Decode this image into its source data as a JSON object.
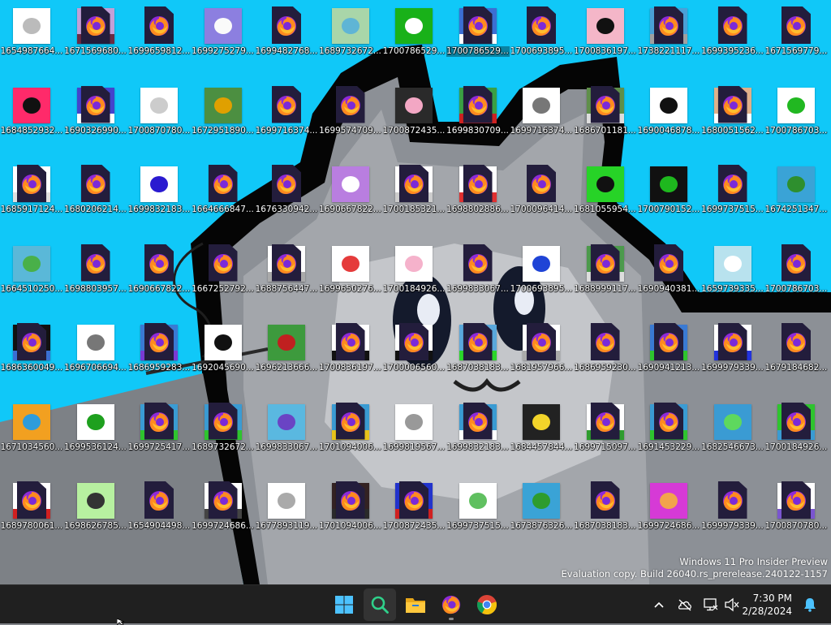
{
  "desktop": {
    "icons": [
      {
        "label": "1654987664...",
        "kind": "image",
        "color": "#ffffff",
        "accent": "#bbbbbb"
      },
      {
        "label": "1671569680...",
        "kind": "firefox_thumb",
        "color": "#c2a0d6",
        "accent": "#6b2b44"
      },
      {
        "label": "1699659812...",
        "kind": "firefox"
      },
      {
        "label": "1699275279...",
        "kind": "image",
        "color": "#8c7fe0",
        "accent": "#fafafa"
      },
      {
        "label": "1699482768...",
        "kind": "firefox"
      },
      {
        "label": "1689732672...",
        "kind": "image",
        "color": "#a9d6a9",
        "accent": "#5fb5d5"
      },
      {
        "label": "1700786529...",
        "kind": "image",
        "color": "#19b119",
        "accent": "#ffffff"
      },
      {
        "label": "1700786529...",
        "kind": "firefox_thumb",
        "color": "#3b6fd3",
        "accent": "#ffffff",
        "selected": true
      },
      {
        "label": "1700693895...",
        "kind": "firefox"
      },
      {
        "label": "1700836197...",
        "kind": "image",
        "color": "#f4b6c8",
        "accent": "#111111"
      },
      {
        "label": "1738221117...",
        "kind": "firefox_thumb",
        "color": "#4aa0d6",
        "accent": "#a0a0a0"
      },
      {
        "label": "1699395236...",
        "kind": "firefox"
      },
      {
        "label": "1671569779...",
        "kind": "firefox"
      },
      {
        "label": "1684852932...",
        "kind": "image",
        "color": "#ff2a6a",
        "accent": "#111111"
      },
      {
        "label": "1690326990...",
        "kind": "firefox_thumb",
        "color": "#4444cc",
        "accent": "#ffffff"
      },
      {
        "label": "1700870780...",
        "kind": "image",
        "color": "#ffffff",
        "accent": "#cccccc"
      },
      {
        "label": "1672951890...",
        "kind": "image",
        "color": "#4c8f41",
        "accent": "#e0a000"
      },
      {
        "label": "1699716374...",
        "kind": "firefox"
      },
      {
        "label": "1699574709...",
        "kind": "firefox"
      },
      {
        "label": "1700872435...",
        "kind": "image",
        "color": "#2a2a2a",
        "accent": "#f3a7c4"
      },
      {
        "label": "1699830709...",
        "kind": "firefox_thumb",
        "color": "#3aa044",
        "accent": "#cc2222"
      },
      {
        "label": "1699716374...",
        "kind": "image",
        "color": "#ffffff",
        "accent": "#777777"
      },
      {
        "label": "1686701181...",
        "kind": "firefox_thumb",
        "color": "#5f8f4a",
        "accent": "#dddddd"
      },
      {
        "label": "1690046878...",
        "kind": "image",
        "color": "#ffffff",
        "accent": "#111111"
      },
      {
        "label": "1680051562...",
        "kind": "firefox_thumb",
        "color": "#e0b08a",
        "accent": "#ffffff"
      },
      {
        "label": "1700786703...",
        "kind": "image",
        "color": "#ffffff",
        "accent": "#21b821"
      },
      {
        "label": "1685917124...",
        "kind": "firefox_thumb",
        "color": "#ffffff",
        "accent": "#e0e0e0"
      },
      {
        "label": "1680206214...",
        "kind": "firefox"
      },
      {
        "label": "1699832183...",
        "kind": "image",
        "color": "#ffffff",
        "accent": "#2a1ad0"
      },
      {
        "label": "1664666847...",
        "kind": "firefox"
      },
      {
        "label": "1676330942...",
        "kind": "firefox"
      },
      {
        "label": "1690667822...",
        "kind": "image",
        "color": "#b97ee0",
        "accent": "#ffffff"
      },
      {
        "label": "1700185321...",
        "kind": "firefox_thumb",
        "color": "#ffffff",
        "accent": "#cccccc"
      },
      {
        "label": "1698802886...",
        "kind": "firefox_thumb",
        "color": "#ffffff",
        "accent": "#e03030"
      },
      {
        "label": "1700096414...",
        "kind": "firefox"
      },
      {
        "label": "1681055954...",
        "kind": "image",
        "color": "#27d327",
        "accent": "#111111"
      },
      {
        "label": "1700790152...",
        "kind": "image",
        "color": "#111111",
        "accent": "#1eb81e"
      },
      {
        "label": "1699737515...",
        "kind": "firefox"
      },
      {
        "label": "1674251347...",
        "kind": "image",
        "color": "#3aa3d6",
        "accent": "#2e8f2e"
      },
      {
        "label": "1664510250...",
        "kind": "image",
        "color": "#5ab8d8",
        "accent": "#49b049"
      },
      {
        "label": "1698803957...",
        "kind": "firefox"
      },
      {
        "label": "1690667822...",
        "kind": "firefox"
      },
      {
        "label": "1667252792...",
        "kind": "firefox"
      },
      {
        "label": "1688756447...",
        "kind": "firefox_thumb",
        "color": "#ffffff",
        "accent": "#aaaaaa"
      },
      {
        "label": "1699650276...",
        "kind": "image",
        "color": "#ffffff",
        "accent": "#e53b3b"
      },
      {
        "label": "1700184926...",
        "kind": "image",
        "color": "#ffffff",
        "accent": "#f5b2cb"
      },
      {
        "label": "1699833067...",
        "kind": "firefox"
      },
      {
        "label": "1700693895...",
        "kind": "image",
        "color": "#ffffff",
        "accent": "#1f44d6"
      },
      {
        "label": "1688999117...",
        "kind": "firefox_thumb",
        "color": "#4c9a4c",
        "accent": "#dddddd"
      },
      {
        "label": "1690940381...",
        "kind": "firefox"
      },
      {
        "label": "1659739335...",
        "kind": "image",
        "color": "#b8e2ee",
        "accent": "#ffffff"
      },
      {
        "label": "1700786703...",
        "kind": "firefox"
      },
      {
        "label": "1686360049...",
        "kind": "firefox_thumb",
        "color": "#111111",
        "accent": "#3a6fd3"
      },
      {
        "label": "1696706694...",
        "kind": "image",
        "color": "#ffffff",
        "accent": "#777777"
      },
      {
        "label": "1686959283...",
        "kind": "firefox_thumb",
        "color": "#3a7ad3",
        "accent": "#7a3ad3"
      },
      {
        "label": "1692045690...",
        "kind": "image",
        "color": "#ffffff",
        "accent": "#111111"
      },
      {
        "label": "1696213666...",
        "kind": "image",
        "color": "#3d9a3d",
        "accent": "#c02020"
      },
      {
        "label": "1700836197...",
        "kind": "firefox_thumb",
        "color": "#ffffff",
        "accent": "#111111"
      },
      {
        "label": "1700006560...",
        "kind": "firefox_thumb",
        "color": "#ffffff",
        "accent": "#111111"
      },
      {
        "label": "1687038183...",
        "kind": "firefox_thumb",
        "color": "#5aa8dc",
        "accent": "#2bd62b"
      },
      {
        "label": "1681957966...",
        "kind": "firefox_thumb",
        "color": "#ffffff",
        "accent": "#aaaaaa"
      },
      {
        "label": "1686959230...",
        "kind": "firefox"
      },
      {
        "label": "1690941213...",
        "kind": "firefox_thumb",
        "color": "#3a7ad3",
        "accent": "#2ec42e"
      },
      {
        "label": "1699979339...",
        "kind": "firefox_thumb",
        "color": "#ffffff",
        "accent": "#2233dd"
      },
      {
        "label": "1679184682...",
        "kind": "firefox"
      },
      {
        "label": "1671034560...",
        "kind": "image",
        "color": "#f2a020",
        "accent": "#2e9cdb"
      },
      {
        "label": "1699536124...",
        "kind": "image",
        "color": "#ffffff",
        "accent": "#1ea01e"
      },
      {
        "label": "1699725417...",
        "kind": "firefox_thumb",
        "color": "#3a9bd3",
        "accent": "#2ec42e"
      },
      {
        "label": "1689732672...",
        "kind": "firefox_thumb",
        "color": "#3a9bd3",
        "accent": "#2ec42e"
      },
      {
        "label": "1699833067...",
        "kind": "image",
        "color": "#5ab8e0",
        "accent": "#6a44c4"
      },
      {
        "label": "1701094006...",
        "kind": "firefox_thumb",
        "color": "#3a9bd3",
        "accent": "#e7c21a"
      },
      {
        "label": "1699819567...",
        "kind": "image",
        "color": "#ffffff",
        "accent": "#999999"
      },
      {
        "label": "1699832183...",
        "kind": "firefox_thumb",
        "color": "#3a9bd3",
        "accent": "#ffffff"
      },
      {
        "label": "1684457844...",
        "kind": "image",
        "color": "#222222",
        "accent": "#f2d42a"
      },
      {
        "label": "1699715097...",
        "kind": "firefox_thumb",
        "color": "#ffffff",
        "accent": "#2e9c2e"
      },
      {
        "label": "1691453229...",
        "kind": "firefox_thumb",
        "color": "#3a9bd3",
        "accent": "#2ec42e"
      },
      {
        "label": "1682546673...",
        "kind": "image",
        "color": "#3a9bd3",
        "accent": "#5ed85e"
      },
      {
        "label": "1700184926...",
        "kind": "firefox_thumb",
        "color": "#2ec42e",
        "accent": "#3a9bd3"
      },
      {
        "label": "1689780061...",
        "kind": "firefox_thumb",
        "color": "#ffffff",
        "accent": "#d02020"
      },
      {
        "label": "1698626785...",
        "kind": "image",
        "color": "#b7f0a0",
        "accent": "#333333"
      },
      {
        "label": "1654904498...",
        "kind": "firefox"
      },
      {
        "label": "1699724686...",
        "kind": "firefox_thumb",
        "color": "#ffffff",
        "accent": "#444444"
      },
      {
        "label": "1677893119...",
        "kind": "image",
        "color": "#ffffff",
        "accent": "#aaaaaa"
      },
      {
        "label": "1701094006...",
        "kind": "firefox_thumb",
        "color": "#332222",
        "accent": "#2a2a2a"
      },
      {
        "label": "1700872435...",
        "kind": "firefox_thumb",
        "color": "#2233cc",
        "accent": "#d02020"
      },
      {
        "label": "1699737515...",
        "kind": "image",
        "color": "#ffffff",
        "accent": "#60c060"
      },
      {
        "label": "1673876326...",
        "kind": "image",
        "color": "#3aa3d6",
        "accent": "#2e9c2e"
      },
      {
        "label": "1687038183...",
        "kind": "firefox"
      },
      {
        "label": "1699724686...",
        "kind": "image",
        "color": "#d63ad6",
        "accent": "#f2a44c"
      },
      {
        "label": "1699979339...",
        "kind": "firefox"
      },
      {
        "label": "1700870780...",
        "kind": "firefox_thumb",
        "color": "#ffffff",
        "accent": "#7a55d0"
      }
    ]
  },
  "watermark": {
    "line1": "Windows 11 Pro Insider Preview",
    "line2": "Evaluation copy. Build 26040.rs_prerelease.240122-1157"
  },
  "taskbar": {
    "apps": [
      {
        "name": "start",
        "icon": "windows-logo-icon"
      },
      {
        "name": "search",
        "icon": "search-icon",
        "active": true
      },
      {
        "name": "file-explorer",
        "icon": "folder-icon"
      },
      {
        "name": "firefox",
        "icon": "firefox-icon",
        "running": true
      },
      {
        "name": "chrome",
        "icon": "chrome-icon"
      }
    ],
    "tray": {
      "icons": [
        "chevron-up-icon",
        "cloud-off-icon",
        "network-icon",
        "volume-muted-icon"
      ],
      "time": "7:30 PM",
      "date": "2/28/2024",
      "notification_icon": "bell-icon"
    }
  },
  "colors": {
    "sky": "#10c8f8",
    "wall_gray": "#8c9096",
    "taskbar": "#202020",
    "accent": "#4cc2ff"
  }
}
